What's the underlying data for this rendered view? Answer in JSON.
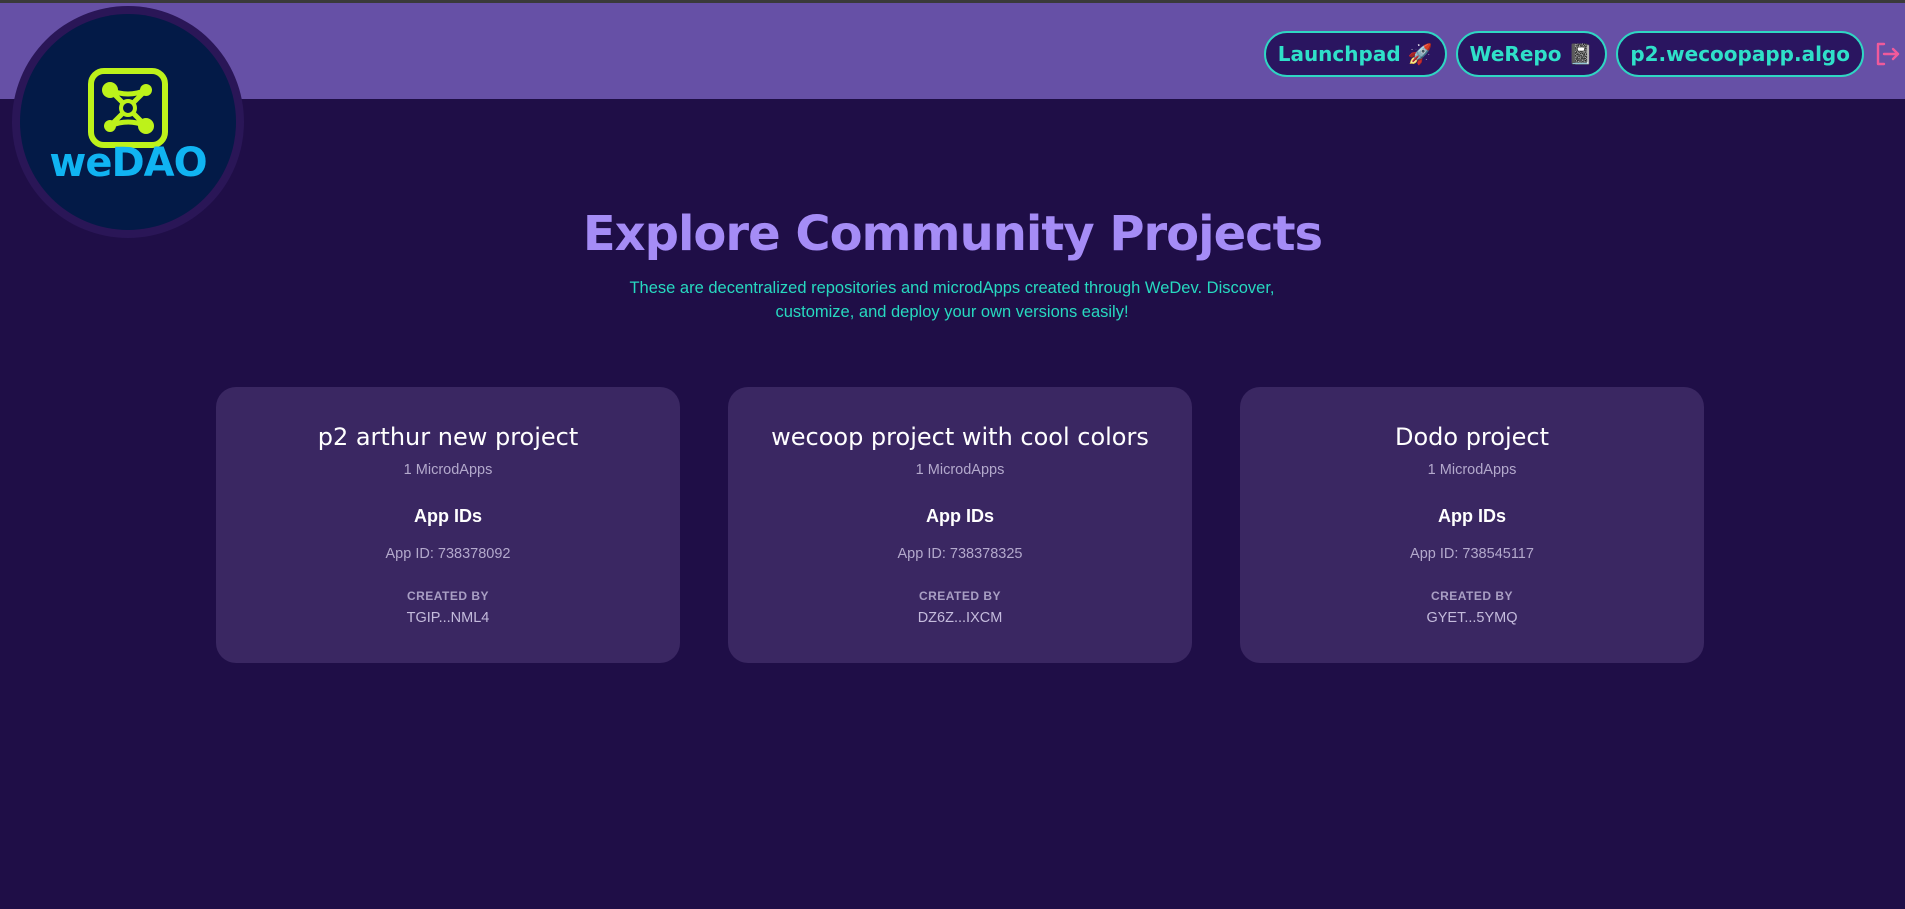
{
  "brand": {
    "name": "weDAO",
    "colors": {
      "accent": "#a58cf6",
      "teal": "#2fe0c9",
      "logo_green": "#bdf21a",
      "logo_blue": "#10b4f2"
    }
  },
  "nav": {
    "launchpad": "Launchpad 🚀",
    "werepo": "WeRepo 📓",
    "account": "p2.wecoopapp.algo",
    "logout_icon": "logout-icon"
  },
  "main": {
    "title": "Explore Community Projects",
    "subtitle": "These are decentralized repositories and microdApps created through WeDev. Discover, customize, and deploy your own versions easily!"
  },
  "projects": [
    {
      "name": "p2 arthur new project",
      "count": "1 MicrodApps",
      "ids_heading": "App IDs",
      "app_id": "App ID: 738378092",
      "created_label": "CREATED BY",
      "creator": "TGIP...NML4"
    },
    {
      "name": "wecoop project with cool colors",
      "count": "1 MicrodApps",
      "ids_heading": "App IDs",
      "app_id": "App ID: 738378325",
      "created_label": "CREATED BY",
      "creator": "DZ6Z...IXCM"
    },
    {
      "name": "Dodo project",
      "count": "1 MicrodApps",
      "ids_heading": "App IDs",
      "app_id": "App ID: 738545117",
      "created_label": "CREATED BY",
      "creator": "GYET...5YMQ"
    }
  ]
}
